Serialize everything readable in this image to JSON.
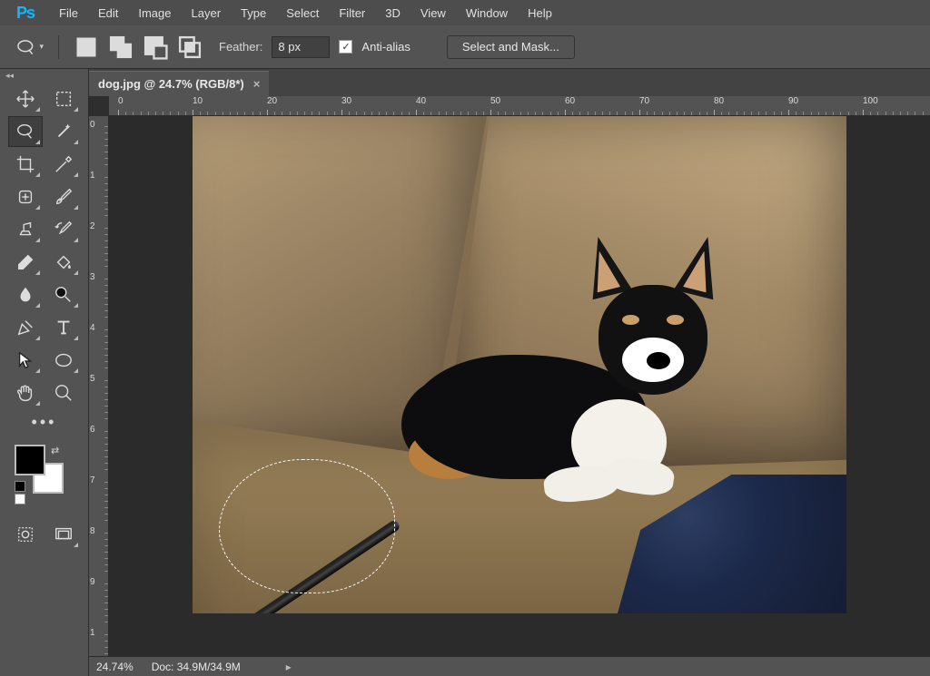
{
  "app": {
    "name": "Ps"
  },
  "menu": [
    "File",
    "Edit",
    "Image",
    "Layer",
    "Type",
    "Select",
    "Filter",
    "3D",
    "View",
    "Window",
    "Help"
  ],
  "options": {
    "feather_label": "Feather:",
    "feather_value": "8 px",
    "antialias_label": "Anti-alias",
    "antialias_checked": true,
    "select_mask_label": "Select and Mask..."
  },
  "document": {
    "tab_title": "dog.jpg @ 24.7% (RGB/8*)",
    "zoom_display": "24.74%",
    "doc_size": "Doc: 34.9M/34.9M"
  },
  "ruler_top": [
    "0",
    "10",
    "20",
    "30",
    "40",
    "50",
    "60",
    "70",
    "80",
    "90",
    "100"
  ],
  "ruler_left": [
    "0",
    "1",
    "2",
    "3",
    "4",
    "5",
    "6",
    "7",
    "8",
    "9",
    "1"
  ],
  "tools": [
    [
      "move",
      "marquee"
    ],
    [
      "lasso",
      "magic-wand"
    ],
    [
      "crop",
      "eyedropper"
    ],
    [
      "healing-brush",
      "brush"
    ],
    [
      "clone-stamp",
      "history-brush"
    ],
    [
      "eraser",
      "paint-bucket"
    ],
    [
      "blur",
      "dodge"
    ],
    [
      "pen",
      "type"
    ],
    [
      "path-select",
      "ellipse-shape"
    ],
    [
      "hand",
      "zoom"
    ]
  ],
  "bottom_tools": [
    [
      "quick-mask",
      "screen-mode"
    ]
  ]
}
